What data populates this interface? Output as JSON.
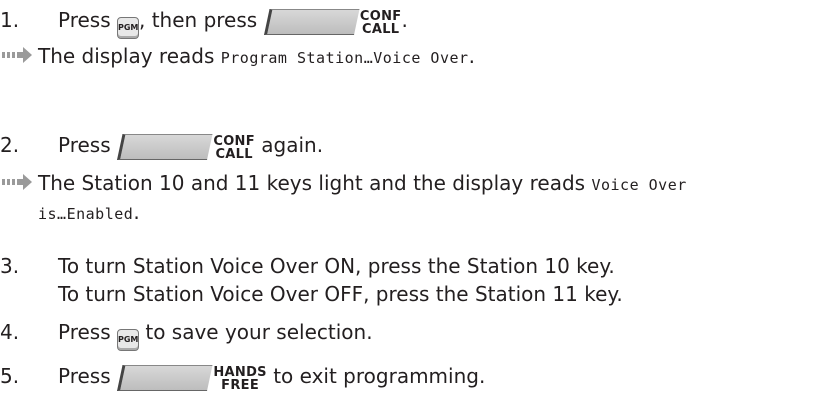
{
  "steps": [
    {
      "number": "1.",
      "press": "Press",
      "mid": ", then press",
      "key_pgm": "PGM",
      "conf_label_1": "CONF",
      "conf_label_2": "CALL",
      "end": "."
    },
    {
      "number": "2.",
      "press": "Press",
      "conf_label_1": "CONF",
      "conf_label_2": "CALL",
      "end": "again."
    },
    {
      "number": "3.",
      "line1": "To turn Station Voice Over ON, press the Station 10 key.",
      "line2": "To turn Station Voice Over OFF, press the Station 11 key."
    },
    {
      "number": "4.",
      "press": "Press",
      "key_pgm": "PGM",
      "end": "to save your selection."
    },
    {
      "number": "5.",
      "press": "Press",
      "hands_label_1": "HANDS",
      "hands_label_2": "FREE",
      "end": "to exit programming."
    }
  ],
  "results": [
    {
      "text": "The display reads",
      "display": "Program Station…Voice Over",
      "end": "."
    },
    {
      "text": "The Station 10 and 11 keys light and the display reads",
      "display1": "Voice Over",
      "display2": "is…Enabled",
      "end": "."
    }
  ],
  "colors": {
    "text": "#231f20",
    "arrow": "#9a9a9a"
  },
  "icons": {
    "result": "arrow-right-icon",
    "pgm": "pgm-key-icon",
    "conf": "conf-call-key-icon",
    "hands": "hands-free-key-icon"
  }
}
